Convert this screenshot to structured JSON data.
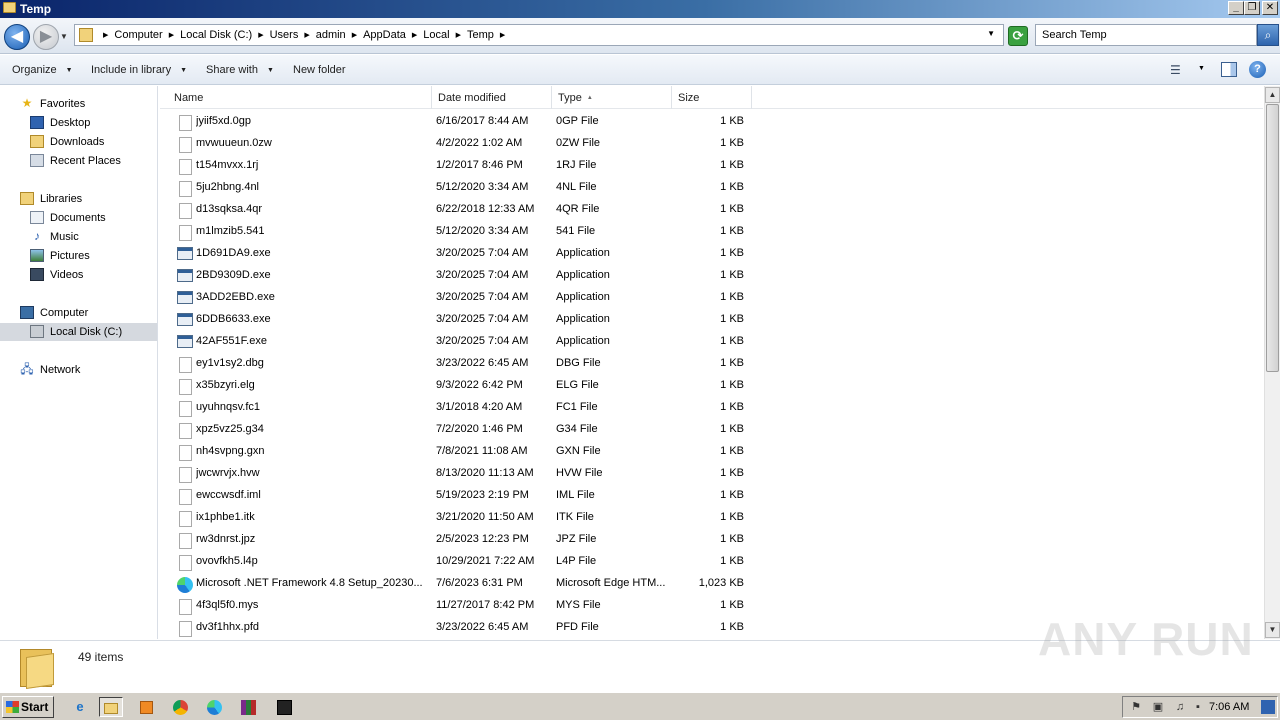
{
  "window": {
    "title": "Temp"
  },
  "address": {
    "crumbs": [
      "Computer",
      "Local Disk (C:)",
      "Users",
      "admin",
      "AppData",
      "Local",
      "Temp"
    ],
    "search_placeholder": "Search Temp"
  },
  "toolbar": {
    "organize": "Organize",
    "include_in_library": "Include in library",
    "share_with": "Share with",
    "new_folder": "New folder"
  },
  "nav": {
    "favorites": "Favorites",
    "desktop": "Desktop",
    "downloads": "Downloads",
    "recent_places": "Recent Places",
    "libraries": "Libraries",
    "documents": "Documents",
    "music": "Music",
    "pictures": "Pictures",
    "videos": "Videos",
    "computer": "Computer",
    "local_disk": "Local Disk (C:)",
    "network": "Network"
  },
  "columns": {
    "name": "Name",
    "date": "Date modified",
    "type": "Type",
    "size": "Size"
  },
  "files": [
    {
      "name": "jyiif5xd.0gp",
      "date": "6/16/2017 8:44 AM",
      "type": "0GP File",
      "size": "1 KB",
      "icon": "generic"
    },
    {
      "name": "mvwuueun.0zw",
      "date": "4/2/2022 1:02 AM",
      "type": "0ZW File",
      "size": "1 KB",
      "icon": "generic"
    },
    {
      "name": "t154mvxx.1rj",
      "date": "1/2/2017 8:46 PM",
      "type": "1RJ File",
      "size": "1 KB",
      "icon": "generic"
    },
    {
      "name": "5ju2hbng.4nl",
      "date": "5/12/2020 3:34 AM",
      "type": "4NL File",
      "size": "1 KB",
      "icon": "generic"
    },
    {
      "name": "d13sqksa.4qr",
      "date": "6/22/2018 12:33 AM",
      "type": "4QR File",
      "size": "1 KB",
      "icon": "generic"
    },
    {
      "name": "m1lmzib5.541",
      "date": "5/12/2020 3:34 AM",
      "type": "541 File",
      "size": "1 KB",
      "icon": "generic"
    },
    {
      "name": "1D691DA9.exe",
      "date": "3/20/2025 7:04 AM",
      "type": "Application",
      "size": "1 KB",
      "icon": "app"
    },
    {
      "name": "2BD9309D.exe",
      "date": "3/20/2025 7:04 AM",
      "type": "Application",
      "size": "1 KB",
      "icon": "app"
    },
    {
      "name": "3ADD2EBD.exe",
      "date": "3/20/2025 7:04 AM",
      "type": "Application",
      "size": "1 KB",
      "icon": "app"
    },
    {
      "name": "6DDB6633.exe",
      "date": "3/20/2025 7:04 AM",
      "type": "Application",
      "size": "1 KB",
      "icon": "app"
    },
    {
      "name": "42AF551F.exe",
      "date": "3/20/2025 7:04 AM",
      "type": "Application",
      "size": "1 KB",
      "icon": "app"
    },
    {
      "name": "ey1v1sy2.dbg",
      "date": "3/23/2022 6:45 AM",
      "type": "DBG File",
      "size": "1 KB",
      "icon": "generic"
    },
    {
      "name": "x35bzyri.elg",
      "date": "9/3/2022 6:42 PM",
      "type": "ELG File",
      "size": "1 KB",
      "icon": "generic"
    },
    {
      "name": "uyuhnqsv.fc1",
      "date": "3/1/2018 4:20 AM",
      "type": "FC1 File",
      "size": "1 KB",
      "icon": "generic"
    },
    {
      "name": "xpz5vz25.g34",
      "date": "7/2/2020 1:46 PM",
      "type": "G34 File",
      "size": "1 KB",
      "icon": "generic"
    },
    {
      "name": "nh4svpng.gxn",
      "date": "7/8/2021 11:08 AM",
      "type": "GXN File",
      "size": "1 KB",
      "icon": "generic"
    },
    {
      "name": "jwcwrvjx.hvw",
      "date": "8/13/2020 11:13 AM",
      "type": "HVW File",
      "size": "1 KB",
      "icon": "generic"
    },
    {
      "name": "ewccwsdf.iml",
      "date": "5/19/2023 2:19 PM",
      "type": "IML File",
      "size": "1 KB",
      "icon": "generic"
    },
    {
      "name": "ix1phbe1.itk",
      "date": "3/21/2020 11:50 AM",
      "type": "ITK File",
      "size": "1 KB",
      "icon": "generic"
    },
    {
      "name": "rw3dnrst.jpz",
      "date": "2/5/2023 12:23 PM",
      "type": "JPZ File",
      "size": "1 KB",
      "icon": "generic"
    },
    {
      "name": "ovovfkh5.l4p",
      "date": "10/29/2021 7:22 AM",
      "type": "L4P File",
      "size": "1 KB",
      "icon": "generic"
    },
    {
      "name": "Microsoft .NET Framework 4.8 Setup_20230...",
      "date": "7/6/2023 6:31 PM",
      "type": "Microsoft Edge HTM...",
      "size": "1,023 KB",
      "icon": "edge"
    },
    {
      "name": "4f3ql5f0.mys",
      "date": "11/27/2017 8:42 PM",
      "type": "MYS File",
      "size": "1 KB",
      "icon": "generic"
    },
    {
      "name": "dv3f1hhx.pfd",
      "date": "3/23/2022 6:45 AM",
      "type": "PFD File",
      "size": "1 KB",
      "icon": "generic"
    }
  ],
  "details": {
    "count": "49 items"
  },
  "watermark": "ANY RUN",
  "taskbar": {
    "start": "Start",
    "clock": "7:06 AM"
  }
}
